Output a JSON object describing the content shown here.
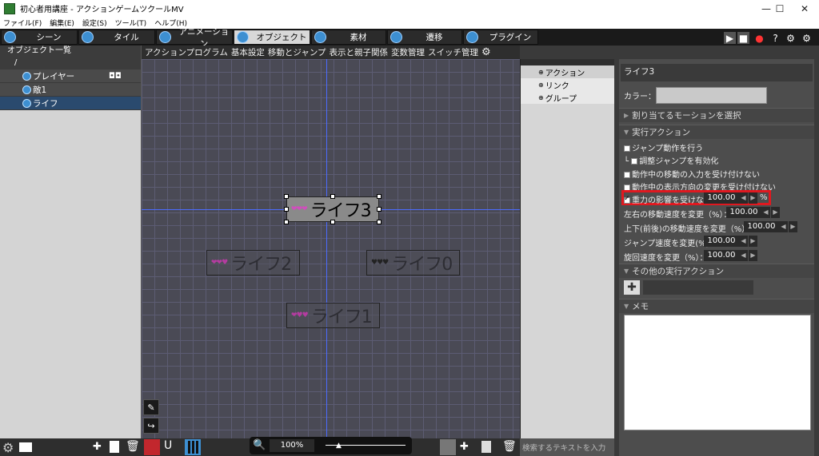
{
  "window": {
    "title": "初心者用講座 - アクションゲームツクールMV",
    "minimize": "—",
    "maximize": "☐",
    "close": "✕"
  },
  "menu": [
    "ファイル(F)",
    "編集(E)",
    "設定(S)",
    "ツール(T)",
    "ヘルプ(H)"
  ],
  "tabs": [
    {
      "label": "シーン",
      "icon": "scene-icon"
    },
    {
      "label": "タイル",
      "icon": "tile-icon"
    },
    {
      "label": "アニメーション",
      "icon": "animation-icon"
    },
    {
      "label": "オブジェクト",
      "icon": "object-icon",
      "active": true
    },
    {
      "label": "素材",
      "icon": "asset-icon"
    },
    {
      "label": "遷移",
      "icon": "transition-icon"
    },
    {
      "label": "プラグイン",
      "icon": "plugin-icon"
    }
  ],
  "left": {
    "header": "オブジェクト一覧",
    "root": "/",
    "items": [
      {
        "label": "プレイヤー",
        "badge": "gamepad-icon"
      },
      {
        "label": "敵1"
      },
      {
        "label": "ライフ",
        "selected": true
      }
    ]
  },
  "canvas_tabs": [
    "アクションプログラム",
    "基本設定",
    "移動とジャンプ",
    "表示と親子関係",
    "変数管理",
    "スイッチ管理"
  ],
  "canvas": {
    "objects": [
      {
        "hearts": "❤❤❤",
        "label": "ライフ3",
        "selected": true
      },
      {
        "hearts": "❤❤♥",
        "label": "ライフ2"
      },
      {
        "hearts": "♥♥♥",
        "label": "ライフ0"
      },
      {
        "hearts": "❤♥♥",
        "label": "ライフ1"
      }
    ],
    "zoom": "100%"
  },
  "mid": {
    "items": [
      "アクション",
      "リンク",
      "グループ"
    ],
    "search_placeholder": "検索するテキストを入力"
  },
  "right": {
    "name": "ライフ3",
    "color_label": "カラー：",
    "motion_label": "割り当てるモーションを選択",
    "exec_action": "実行アクション",
    "jump": "ジャンプ動作を行う",
    "adjust_jump": "調整ジャンプを有効化",
    "no_move_input": "動作中の移動の入力を受け付けない",
    "no_dir_change": "動作中の表示方向の変更を受け付けない",
    "gravity": "重力の影響を受けない",
    "gravity_val": "100.00",
    "pct": "%",
    "lr_speed": "左右の移動速度を変更（%）：",
    "lr_val": "100.00",
    "ud_speed": "上下(前後)の移動速度を変更（%）：",
    "ud_val": "100.00",
    "jump_speed": "ジャンプ速度を変更(%)：",
    "jump_val": "100.00",
    "rot_speed": "旋回速度を変更（%）：",
    "rot_val": "100.00",
    "other_action": "その他の実行アクション",
    "memo": "メモ"
  },
  "colors": {
    "accent": "#3d8fd1",
    "highlight": "#e0181f",
    "panel": "#4d4d4d"
  }
}
